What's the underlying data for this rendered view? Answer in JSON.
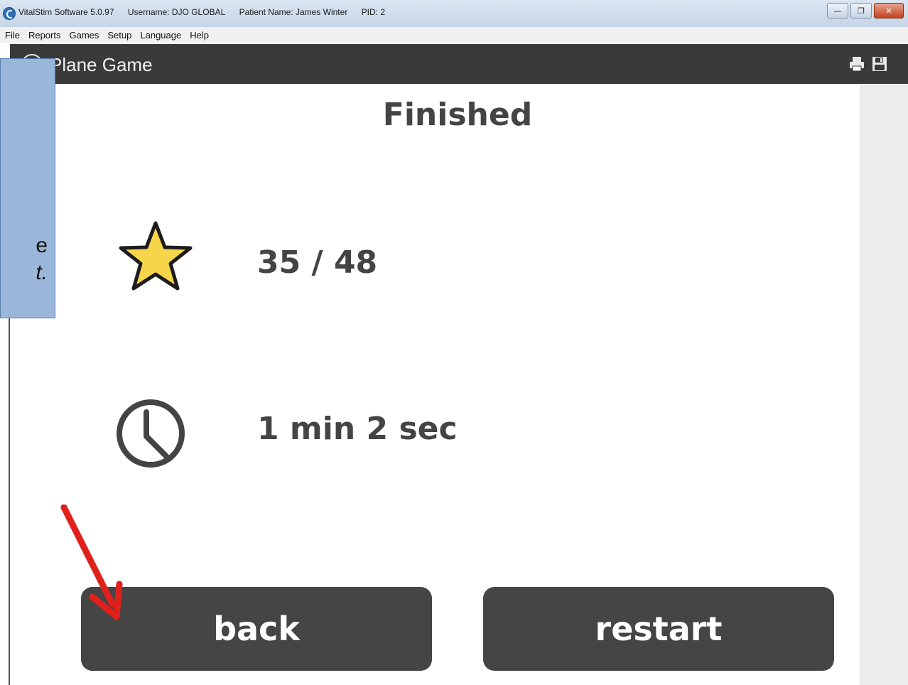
{
  "window": {
    "app_title": "VitalStim Software 5.0.97",
    "username": "Username: DJO GLOBAL",
    "patient": "Patient Name: James Winter",
    "pid": "PID: 2",
    "minimize_icon": "minimize-icon",
    "restore_icon": "restore-icon",
    "close_icon": "close-icon"
  },
  "menu": [
    "File",
    "Reports",
    "Games",
    "Setup",
    "Language",
    "Help"
  ],
  "header": {
    "title": "Plane Game",
    "print_icon": "print-icon",
    "save_icon": "save-icon"
  },
  "result": {
    "heading": "Finished",
    "score": "35 / 48",
    "time": "1 min 2 sec"
  },
  "buttons": {
    "back": "back",
    "restart": "restart"
  },
  "callout": {
    "line1": "e",
    "line2": "t."
  },
  "colors": {
    "star_fill": "#f7d54a",
    "button_bg": "#454545",
    "header_bg": "#3a3a3a",
    "callout_bg": "#9ab6d8",
    "arrow": "#e0201b"
  }
}
